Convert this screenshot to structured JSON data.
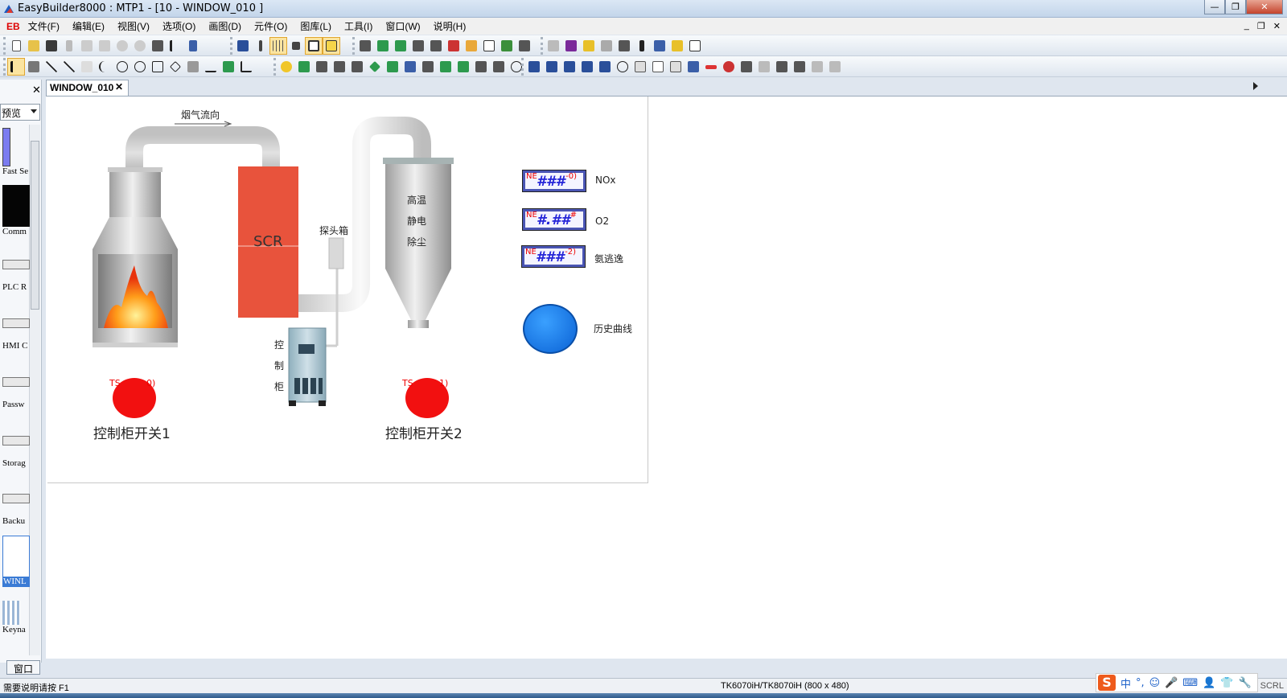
{
  "window": {
    "title": "EasyBuilder8000 : MTP1 - [10 - WINDOW_010 ]",
    "minimize": "—",
    "restore": "❐",
    "close": "✕"
  },
  "menubar": {
    "logo": "EB",
    "items": [
      "文件(F)",
      "编辑(E)",
      "视图(V)",
      "选项(O)",
      "画图(D)",
      "元件(O)",
      "图库(L)",
      "工具(I)",
      "窗口(W)",
      "说明(H)"
    ],
    "mdi_controls": [
      "_",
      "❐",
      "✕"
    ]
  },
  "left_panel": {
    "close": "✕",
    "dropdown_value": "预览",
    "items": [
      "Fast Se",
      "Comm",
      "PLC R",
      "HMI C",
      "Passw",
      "Storag",
      "Backu",
      "WINL",
      "Keyna"
    ],
    "bottom_tab": "窗口"
  },
  "document_tab": {
    "label": "WINDOW_010",
    "close": "✕"
  },
  "screen": {
    "flow_label": "烟气流向",
    "scr_label": "SCR",
    "probe_box_label": "探头箱",
    "cabinet_label": [
      "控",
      "制",
      "柜"
    ],
    "precipitator_label": [
      "高温",
      "静电",
      "除尘"
    ],
    "displays": [
      {
        "ne": "NE",
        "value": "###",
        "suffix": "-0)",
        "label": "NOx"
      },
      {
        "ne": "NE",
        "value": "#.##",
        "suffix": "#",
        "label": "O2"
      },
      {
        "ne": "NE",
        "value": "###",
        "suffix": "-2)",
        "label": "氨逃逸"
      }
    ],
    "trend_label": "历史曲线",
    "switches": [
      {
        "ts": "TS",
        "ts_suffix": "0)",
        "label": "控制柜开关1"
      },
      {
        "ts": "TS",
        "ts_suffix": "1)",
        "label": "控制柜开关2"
      }
    ]
  },
  "statusbar": {
    "help": "需要说明请按 F1",
    "model": "TK6070iH/TK8070iH (800 x 480)",
    "scrl": "SCRL"
  },
  "ime": {
    "logo": "S",
    "items": [
      "中",
      "°,",
      "☺",
      "🎤",
      "⌨",
      "👤",
      "👕",
      "🔧"
    ]
  },
  "colors": {
    "scr": "#e8533c",
    "switch": "#f21010",
    "display_border": "#4a55b4",
    "display_text": "#2525d8",
    "trend": "#1a7ae8"
  }
}
